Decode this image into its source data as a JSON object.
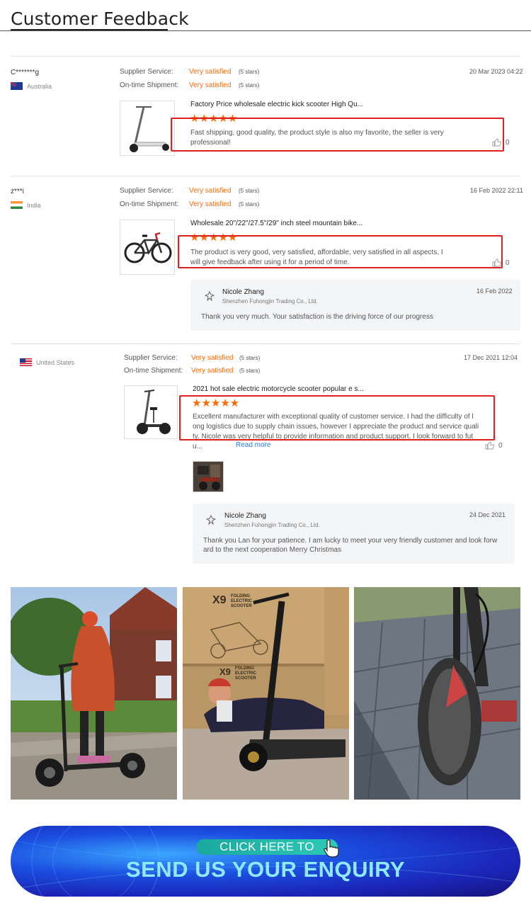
{
  "header": {
    "title": "Customer Feedback"
  },
  "labels": {
    "supplier_service": "Supplier Service:",
    "ontime_shipment": "On-time Shipment:",
    "very_satisfied": "Very satisfied",
    "five_stars": "(5 stars)",
    "stars": "★★★★★",
    "read_more": "Read more"
  },
  "reviews": [
    {
      "user": "C*******g",
      "country": "Australia",
      "date": "20 Mar 2023 04:22",
      "product": "Factory Price wholesale electric kick scooter High Qu...",
      "rating": 5,
      "text_lines": [
        "Fast shipping, good quality, the product style is also my favorite, the seller is very",
        "professional!"
      ],
      "likes": "0"
    },
    {
      "user": "z***i",
      "country": "India",
      "date": "16 Feb 2022 22:11",
      "product": "Wholesale 20\"/22\"/27.5\"/29\" inch steel mountain bike...",
      "rating": 5,
      "text_lines": [
        "The product is very good, very satisfied, affordable, very satisfied in all aspects, I",
        "will give feedback after using it for a period of time."
      ],
      "likes": "0",
      "reply": {
        "seller": "Nicole Zhang",
        "company": "Shenzhen Fuhongjin Trading Co., Ltd.",
        "date": "16 Feb 2022",
        "text_lines": [
          "Thank you very much. Your satisfaction is the driving force of our progress"
        ]
      }
    },
    {
      "user": "",
      "country": "United States",
      "date": "17 Dec 2021 12:04",
      "product": "2021 hot sale electric motorcycle scooter popular e s...",
      "rating": 5,
      "text_lines": [
        "Excellent manufacturer with exceptional quality of customer service. I had the difficulty of l",
        "ong logistics due to supply chain issues, however I appreciate the product and service quali",
        "ty. Nicole was very helpful to provide information and product support. I look forward to fut",
        "u..."
      ],
      "likes": "0",
      "reply": {
        "seller": "Nicole Zhang",
        "company": "Shenzhen Fuhongjin Trading Co., Ltd.",
        "date": "24 Dec 2021",
        "text_lines": [
          "Thank you Lan for your patience. I am lucky to meet your very friendly customer and look forw",
          "ard to the next cooperation Merry Christmas"
        ]
      }
    }
  ],
  "photos": {
    "box_brand": "X9",
    "box_subtitle": "FOLDING ELECTRIC SCOOTER"
  },
  "banner": {
    "cta": "CLICK HERE TO",
    "main": "SEND US YOUR ENQUIRY"
  },
  "colors": {
    "accent": "#ff6a00",
    "highlight_box": "#e02020",
    "link": "#2d7ad6",
    "banner_text": "#8fe9ff"
  }
}
